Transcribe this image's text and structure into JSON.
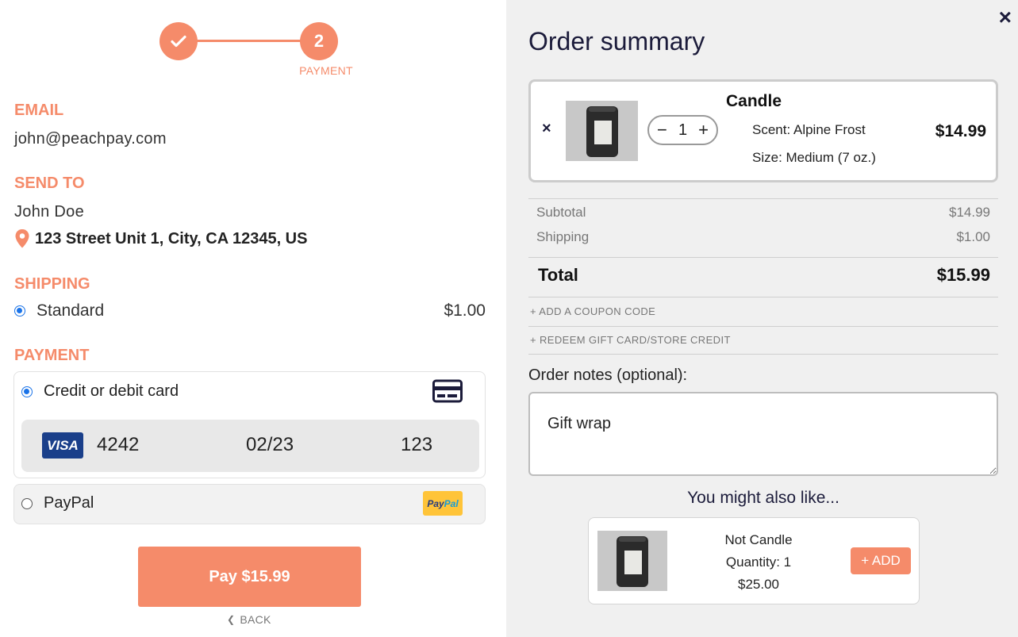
{
  "stepper": {
    "step1_icon": "check-icon",
    "step2_number": "2",
    "step2_label": "PAYMENT"
  },
  "email": {
    "label": "EMAIL",
    "value": "john@peachpay.com"
  },
  "send_to": {
    "label": "SEND TO",
    "name": "John Doe",
    "address": "123 Street Unit 1, City, CA 12345, US"
  },
  "shipping": {
    "label": "SHIPPING",
    "option": "Standard",
    "price": "$1.00",
    "selected": true
  },
  "payment": {
    "label": "PAYMENT",
    "card_option": "Credit or debit card",
    "card_brand": "VISA",
    "card_last4": "4242",
    "card_expiry": "02/23",
    "card_cvc": "123",
    "paypal_option": "PayPal",
    "paypal_badge_1": "Pay",
    "paypal_badge_2": "Pal"
  },
  "pay_button": "Pay $15.99",
  "back_link": "BACK",
  "summary": {
    "title": "Order summary",
    "close": "×",
    "item": {
      "remove": "×",
      "quantity": "1",
      "minus": "−",
      "plus": "+",
      "name": "Candle",
      "scent": "Scent: Alpine Frost",
      "size": "Size: Medium (7 oz.)",
      "price": "$14.99"
    },
    "subtotal_label": "Subtotal",
    "subtotal_value": "$14.99",
    "shipping_label": "Shipping",
    "shipping_value": "$1.00",
    "total_label": "Total",
    "total_value": "$15.99",
    "coupon_link": "+ ADD A COUPON CODE",
    "gift_link": "+ REDEEM GIFT CARD/STORE CREDIT",
    "notes_label": "Order notes (optional):",
    "notes_value": "Gift wrap",
    "recommend_title": "You might also like...",
    "recommend": {
      "name": "Not Candle",
      "quantity": "Quantity: 1",
      "price": "$25.00",
      "add": "+ ADD"
    }
  },
  "colors": {
    "accent": "#f58b6a",
    "panel_bg": "#f0f0f0",
    "navy": "#1b1b3a",
    "radio_blue": "#1a73e8"
  }
}
